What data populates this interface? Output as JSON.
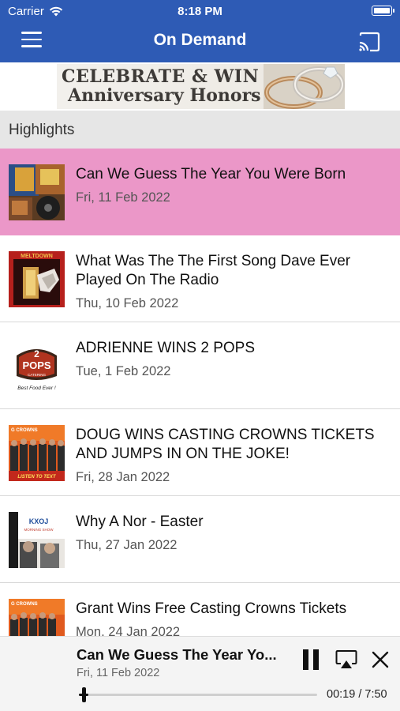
{
  "status_bar": {
    "carrier": "Carrier",
    "time": "8:18 PM"
  },
  "nav": {
    "title": "On Demand",
    "menu_icon": "hamburger-menu-icon",
    "cast_icon": "cast-icon"
  },
  "banner": {
    "line1": "CELEBRATE & WIN",
    "line2": "Anniversary Honors"
  },
  "section": {
    "label": "Highlights"
  },
  "items": [
    {
      "title": "Can We Guess The Year You Were Born",
      "date": "Fri, 11 Feb 2022",
      "selected": true
    },
    {
      "title": "What Was The The First Song Dave Ever Played On The Radio",
      "date": "Thu, 10 Feb 2022",
      "selected": false
    },
    {
      "title": "ADRIENNE WINS 2 POPS",
      "date": "Tue, 1 Feb 2022",
      "selected": false
    },
    {
      "title": "DOUG WINS CASTING CROWNS TICKETS AND JUMPS IN ON THE JOKE!",
      "date": "Fri, 28 Jan 2022",
      "selected": false
    },
    {
      "title": "Why A Nor - Easter",
      "date": "Thu, 27 Jan 2022",
      "selected": false
    },
    {
      "title": "Grant Wins Free Casting Crowns Tickets",
      "date": "Mon, 24 Jan 2022",
      "selected": false
    }
  ],
  "thumbs": {
    "item2_text": "MELTDOWN",
    "item3_logo": "2",
    "item3_logo2": "POPS",
    "item3_sub": "CATERING",
    "item3_tagline": "Best Food Ever !",
    "item4_top": "G CROWNS",
    "item4_bottom": "LISTEN TO TEXT",
    "item5_logo": "KXOJ",
    "item5_show": "MORNING SHOW",
    "item6_top": "G CROWNS"
  },
  "player": {
    "title": "Can We Guess The Year Yo...",
    "date": "Fri, 11 Feb 2022",
    "elapsed": "00:19",
    "separator": " / ",
    "duration": "7:50",
    "progress_fraction": 0.04
  },
  "colors": {
    "header_bg": "#2e5bb5",
    "selected_row": "#eb97c8",
    "section_bg": "#e6e6e6"
  }
}
